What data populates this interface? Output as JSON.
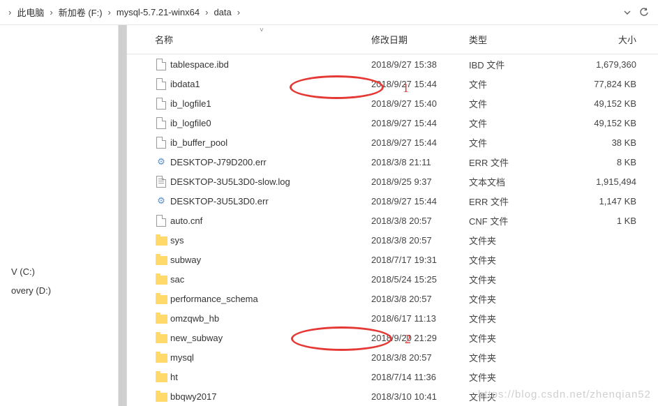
{
  "breadcrumb": {
    "sep": "›",
    "items": [
      "此电脑",
      "新加卷 (F:)",
      "mysql-5.7.21-winx64",
      "data"
    ]
  },
  "columns": {
    "name": "名称",
    "date": "修改日期",
    "type": "类型",
    "size": "大小"
  },
  "sidebar": {
    "drive_c": "V (C:)",
    "drive_d": "overy (D:)",
    "thispc": ""
  },
  "annotations": {
    "label1": "1",
    "label2": "2"
  },
  "watermark": "https://blog.csdn.net/zhenqian52",
  "files": [
    {
      "icon": "file",
      "name": "tablespace.ibd",
      "date": "2018/9/27 15:38",
      "type": "IBD 文件",
      "size": "1,679,360"
    },
    {
      "icon": "file",
      "name": "ibdata1",
      "date": "2018/9/27 15:44",
      "type": "文件",
      "size": "77,824 KB"
    },
    {
      "icon": "file",
      "name": "ib_logfile1",
      "date": "2018/9/27 15:40",
      "type": "文件",
      "size": "49,152 KB"
    },
    {
      "icon": "file",
      "name": "ib_logfile0",
      "date": "2018/9/27 15:44",
      "type": "文件",
      "size": "49,152 KB"
    },
    {
      "icon": "file",
      "name": "ib_buffer_pool",
      "date": "2018/9/27 15:44",
      "type": "文件",
      "size": "38 KB"
    },
    {
      "icon": "gear",
      "name": "DESKTOP-J79D200.err",
      "date": "2018/3/8 21:11",
      "type": "ERR 文件",
      "size": "8 KB"
    },
    {
      "icon": "text",
      "name": "DESKTOP-3U5L3D0-slow.log",
      "date": "2018/9/25 9:37",
      "type": "文本文档",
      "size": "1,915,494"
    },
    {
      "icon": "gear",
      "name": "DESKTOP-3U5L3D0.err",
      "date": "2018/9/27 15:44",
      "type": "ERR 文件",
      "size": "1,147 KB"
    },
    {
      "icon": "file",
      "name": "auto.cnf",
      "date": "2018/3/8 20:57",
      "type": "CNF 文件",
      "size": "1 KB"
    },
    {
      "icon": "folder",
      "name": "sys",
      "date": "2018/3/8 20:57",
      "type": "文件夹",
      "size": ""
    },
    {
      "icon": "folder",
      "name": "subway",
      "date": "2018/7/17 19:31",
      "type": "文件夹",
      "size": ""
    },
    {
      "icon": "folder",
      "name": "sac",
      "date": "2018/5/24 15:25",
      "type": "文件夹",
      "size": ""
    },
    {
      "icon": "folder",
      "name": "performance_schema",
      "date": "2018/3/8 20:57",
      "type": "文件夹",
      "size": ""
    },
    {
      "icon": "folder",
      "name": "omzqwb_hb",
      "date": "2018/6/17 11:13",
      "type": "文件夹",
      "size": ""
    },
    {
      "icon": "folder",
      "name": "new_subway",
      "date": "2018/9/20 21:29",
      "type": "文件夹",
      "size": ""
    },
    {
      "icon": "folder",
      "name": "mysql",
      "date": "2018/3/8 20:57",
      "type": "文件夹",
      "size": ""
    },
    {
      "icon": "folder",
      "name": "ht",
      "date": "2018/7/14 11:36",
      "type": "文件夹",
      "size": ""
    },
    {
      "icon": "folder",
      "name": "bbqwy2017",
      "date": "2018/3/10 10:41",
      "type": "文件夹",
      "size": ""
    }
  ]
}
